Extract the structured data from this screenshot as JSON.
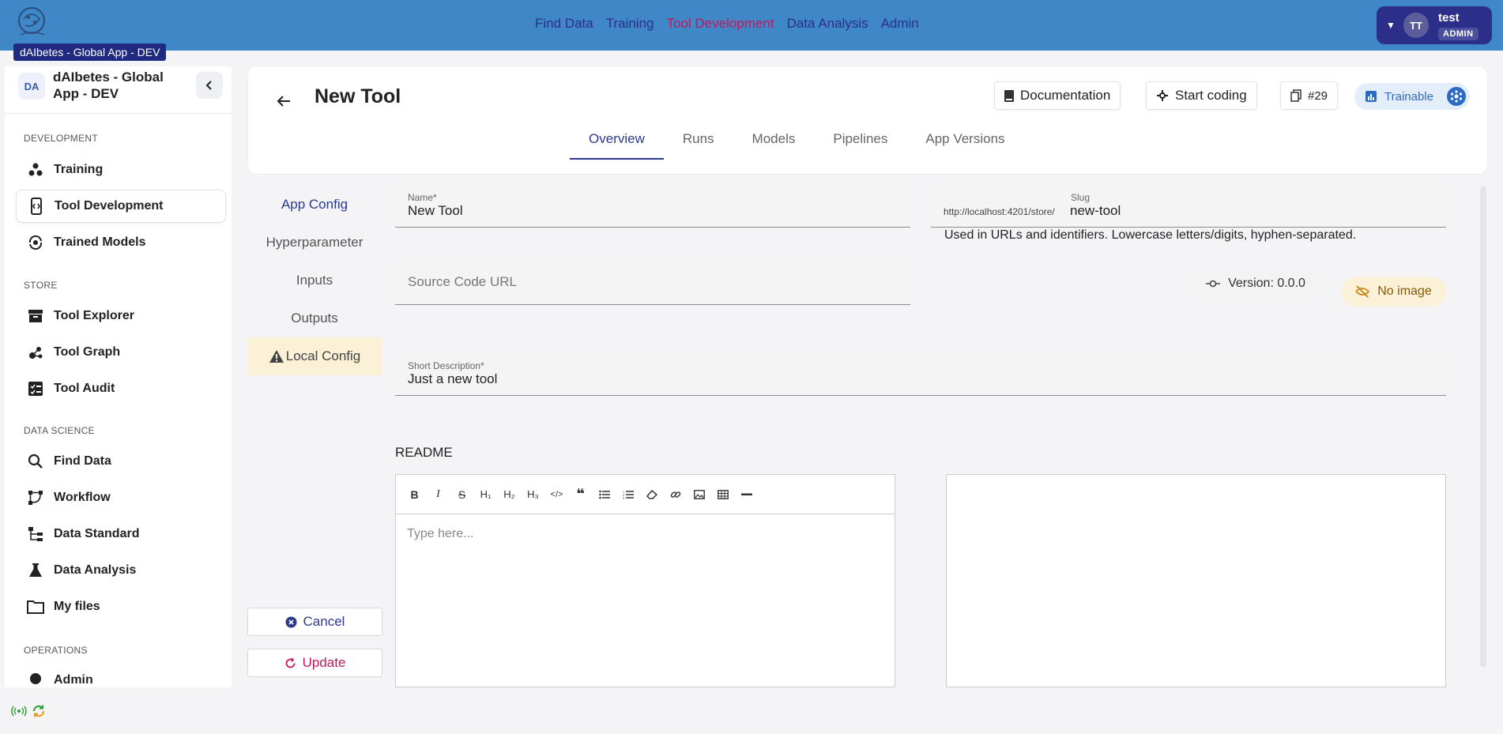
{
  "app": {
    "tooltip": "dAIbetes - Global App - DEV"
  },
  "topnav": {
    "items": [
      "Find Data",
      "Training",
      "Tool Development",
      "Data Analysis",
      "Admin"
    ],
    "active": "Tool Development"
  },
  "user": {
    "initials": "TT",
    "name": "test",
    "role": "ADMIN"
  },
  "sidebar": {
    "badge": "DA",
    "title": "dAIbetes - Global App - DEV",
    "sections": {
      "development": "DEVELOPMENT",
      "store": "STORE",
      "data_science": "DATA SCIENCE",
      "operations": "OPERATIONS"
    },
    "items": {
      "training": "Training",
      "tool_development": "Tool Development",
      "trained_models": "Trained Models",
      "tool_explorer": "Tool Explorer",
      "tool_graph": "Tool Graph",
      "tool_audit": "Tool Audit",
      "find_data": "Find Data",
      "workflow": "Workflow",
      "data_standard": "Data Standard",
      "data_analysis": "Data Analysis",
      "my_files": "My files",
      "admin": "Admin"
    }
  },
  "header": {
    "title": "New Tool",
    "documentation": "Documentation",
    "start_coding": "Start coding",
    "id": "#29",
    "trainable": "Trainable",
    "tabs": [
      "Overview",
      "Runs",
      "Models",
      "Pipelines",
      "App Versions"
    ]
  },
  "config_menu": {
    "app_config": "App Config",
    "hyperparameter": "Hyperparameter",
    "inputs": "Inputs",
    "outputs": "Outputs",
    "local_config": "Local Config",
    "cancel": "Cancel",
    "update": "Update"
  },
  "form": {
    "name_label": "Name*",
    "name_value": "New Tool",
    "slug_label": "Slug",
    "slug_prefix": "http://localhost:4201/store/",
    "slug_value": "new-tool",
    "slug_hint": "Used in URLs and identifiers. Lowercase letters/digits, hyphen-separated.",
    "source_placeholder": "Source Code URL",
    "version": "Version: 0.0.0",
    "no_image": "No image",
    "short_desc_label": "Short Description*",
    "short_desc_value": "Just a new tool",
    "readme_label": "README",
    "readme_placeholder": "Type here..."
  },
  "colors": {
    "topbar": "#3f87c6",
    "nav_active": "#c2185b",
    "primary": "#2d3a8c",
    "warn_bg": "#fbf1d6"
  }
}
